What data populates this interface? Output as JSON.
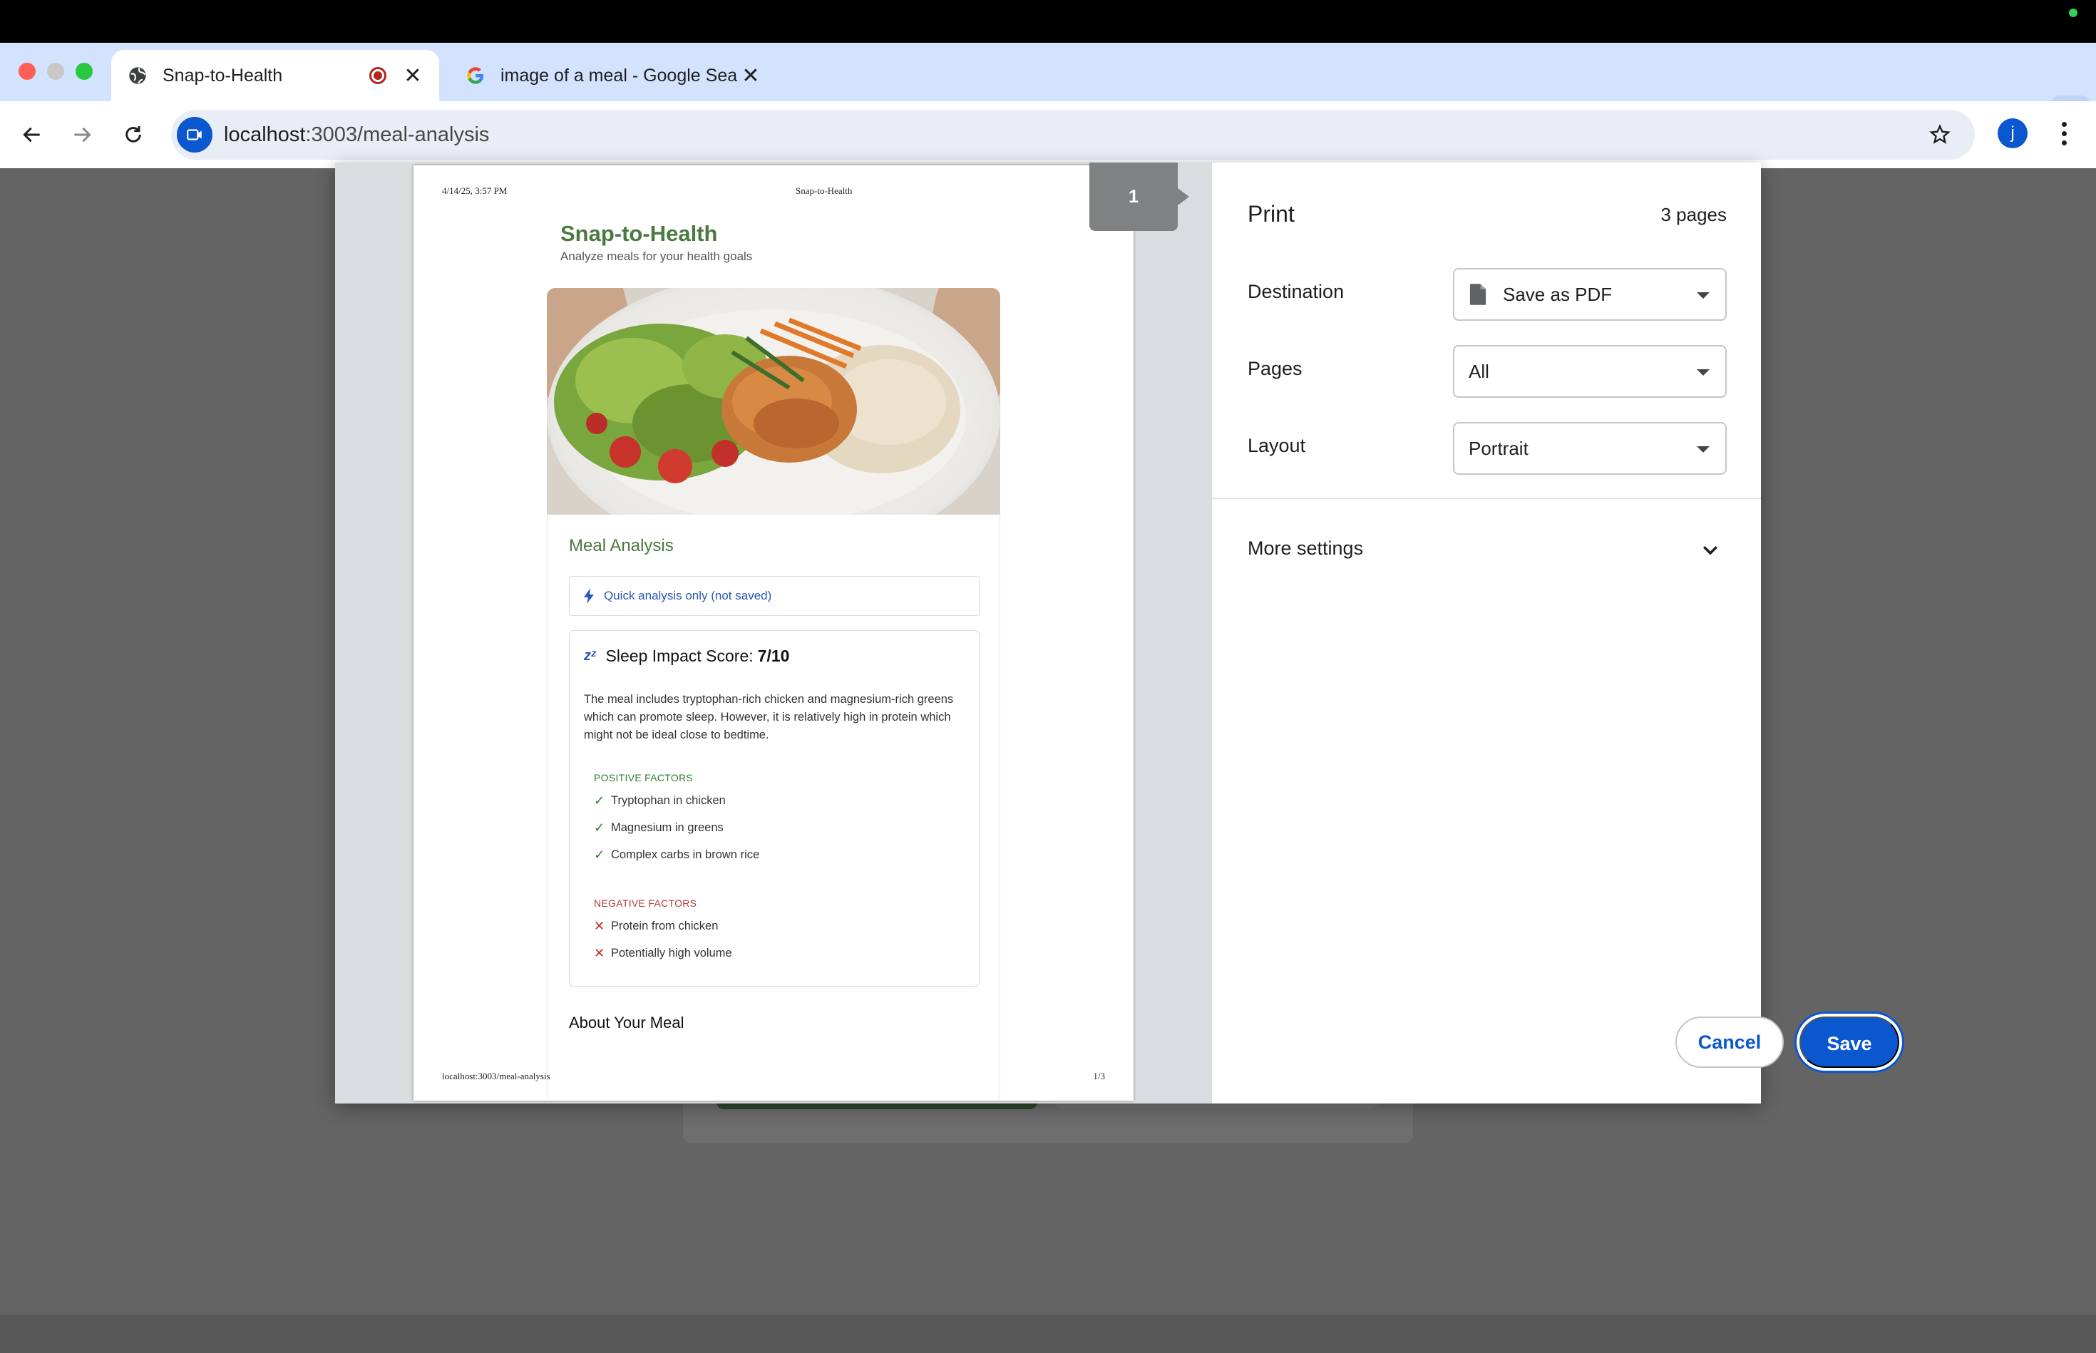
{
  "browser": {
    "tabs": [
      {
        "title": "Snap-to-Health",
        "active": true
      },
      {
        "title": "image of a meal - Google Sea",
        "active": false
      }
    ],
    "new_tab_label": "+",
    "url_host": "localhost",
    "url_rest": ":3003/meal-analysis",
    "profile_initial": "j"
  },
  "preview": {
    "header_date": "4/14/25, 3:57 PM",
    "header_title": "Snap-to-Health",
    "footer_url": "localhost:3003/meal-analysis",
    "footer_page": "1/3",
    "page_indicator": "1",
    "app_title": "Snap-to-Health",
    "app_subtitle": "Analyze meals for your health goals",
    "meal_analysis_heading": "Meal Analysis",
    "quick_analysis": "Quick analysis only (not saved)",
    "sleep_label": "Sleep Impact Score:",
    "sleep_score": "7/10",
    "sleep_text": "The meal includes tryptophan-rich chicken and magnesium-rich greens which can promote sleep. However, it is relatively high in protein which might not be ideal close to bedtime.",
    "positive_heading": "POSITIVE FACTORS",
    "positive": [
      "Tryptophan in chicken",
      "Magnesium in greens",
      "Complex carbs in brown rice"
    ],
    "negative_heading": "NEGATIVE FACTORS",
    "negative": [
      "Protein from chicken",
      "Potentially high volume"
    ],
    "about_heading": "About Your Meal"
  },
  "print": {
    "title": "Print",
    "page_count": "3 pages",
    "destination_label": "Destination",
    "destination_value": "Save as PDF",
    "pages_label": "Pages",
    "pages_value": "All",
    "layout_label": "Layout",
    "layout_value": "Portrait",
    "more_settings": "More settings",
    "cancel": "Cancel",
    "save": "Save"
  },
  "colors": {
    "accent": "#0b57d0",
    "brand_green": "#4a7a3f",
    "positive": "#2f7d32",
    "negative": "#c62828"
  }
}
